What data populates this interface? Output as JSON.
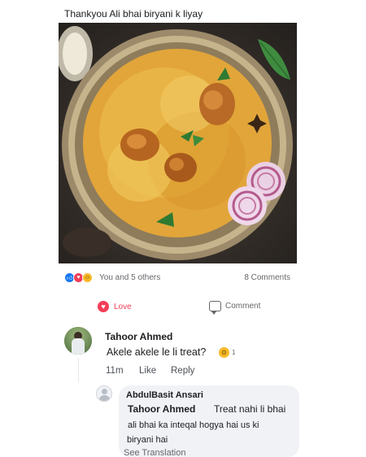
{
  "post": {
    "caption": "Thankyou Ali bhai biryani k liyay",
    "reactions_text": "You and 5 others",
    "comment_count": "8 Comments",
    "reaction_icons": [
      "like-icon",
      "love-icon",
      "haha-icon"
    ]
  },
  "actions": {
    "love_label": "Love",
    "comment_label": "Comment"
  },
  "comments": [
    {
      "author": "Tahoor Ahmed",
      "text": "Akele akele le li treat?",
      "reaction_count": "1",
      "time": "11m",
      "like_label": "Like",
      "reply_label": "Reply"
    },
    {
      "author": "AbdulBasit Ansari",
      "mention": "Tahoor Ahmed",
      "text_line1": "Treat nahi li bhai",
      "text_line2": "ali bhai ka inteqal hogya hai us ki",
      "text_line3": "biryani hai",
      "see_translation": "See Translation"
    }
  ],
  "colors": {
    "love_red": "#f33e58",
    "like_blue": "#1877f2",
    "meta_gray": "#65676b",
    "bubble_bg": "#f0f2f5"
  }
}
